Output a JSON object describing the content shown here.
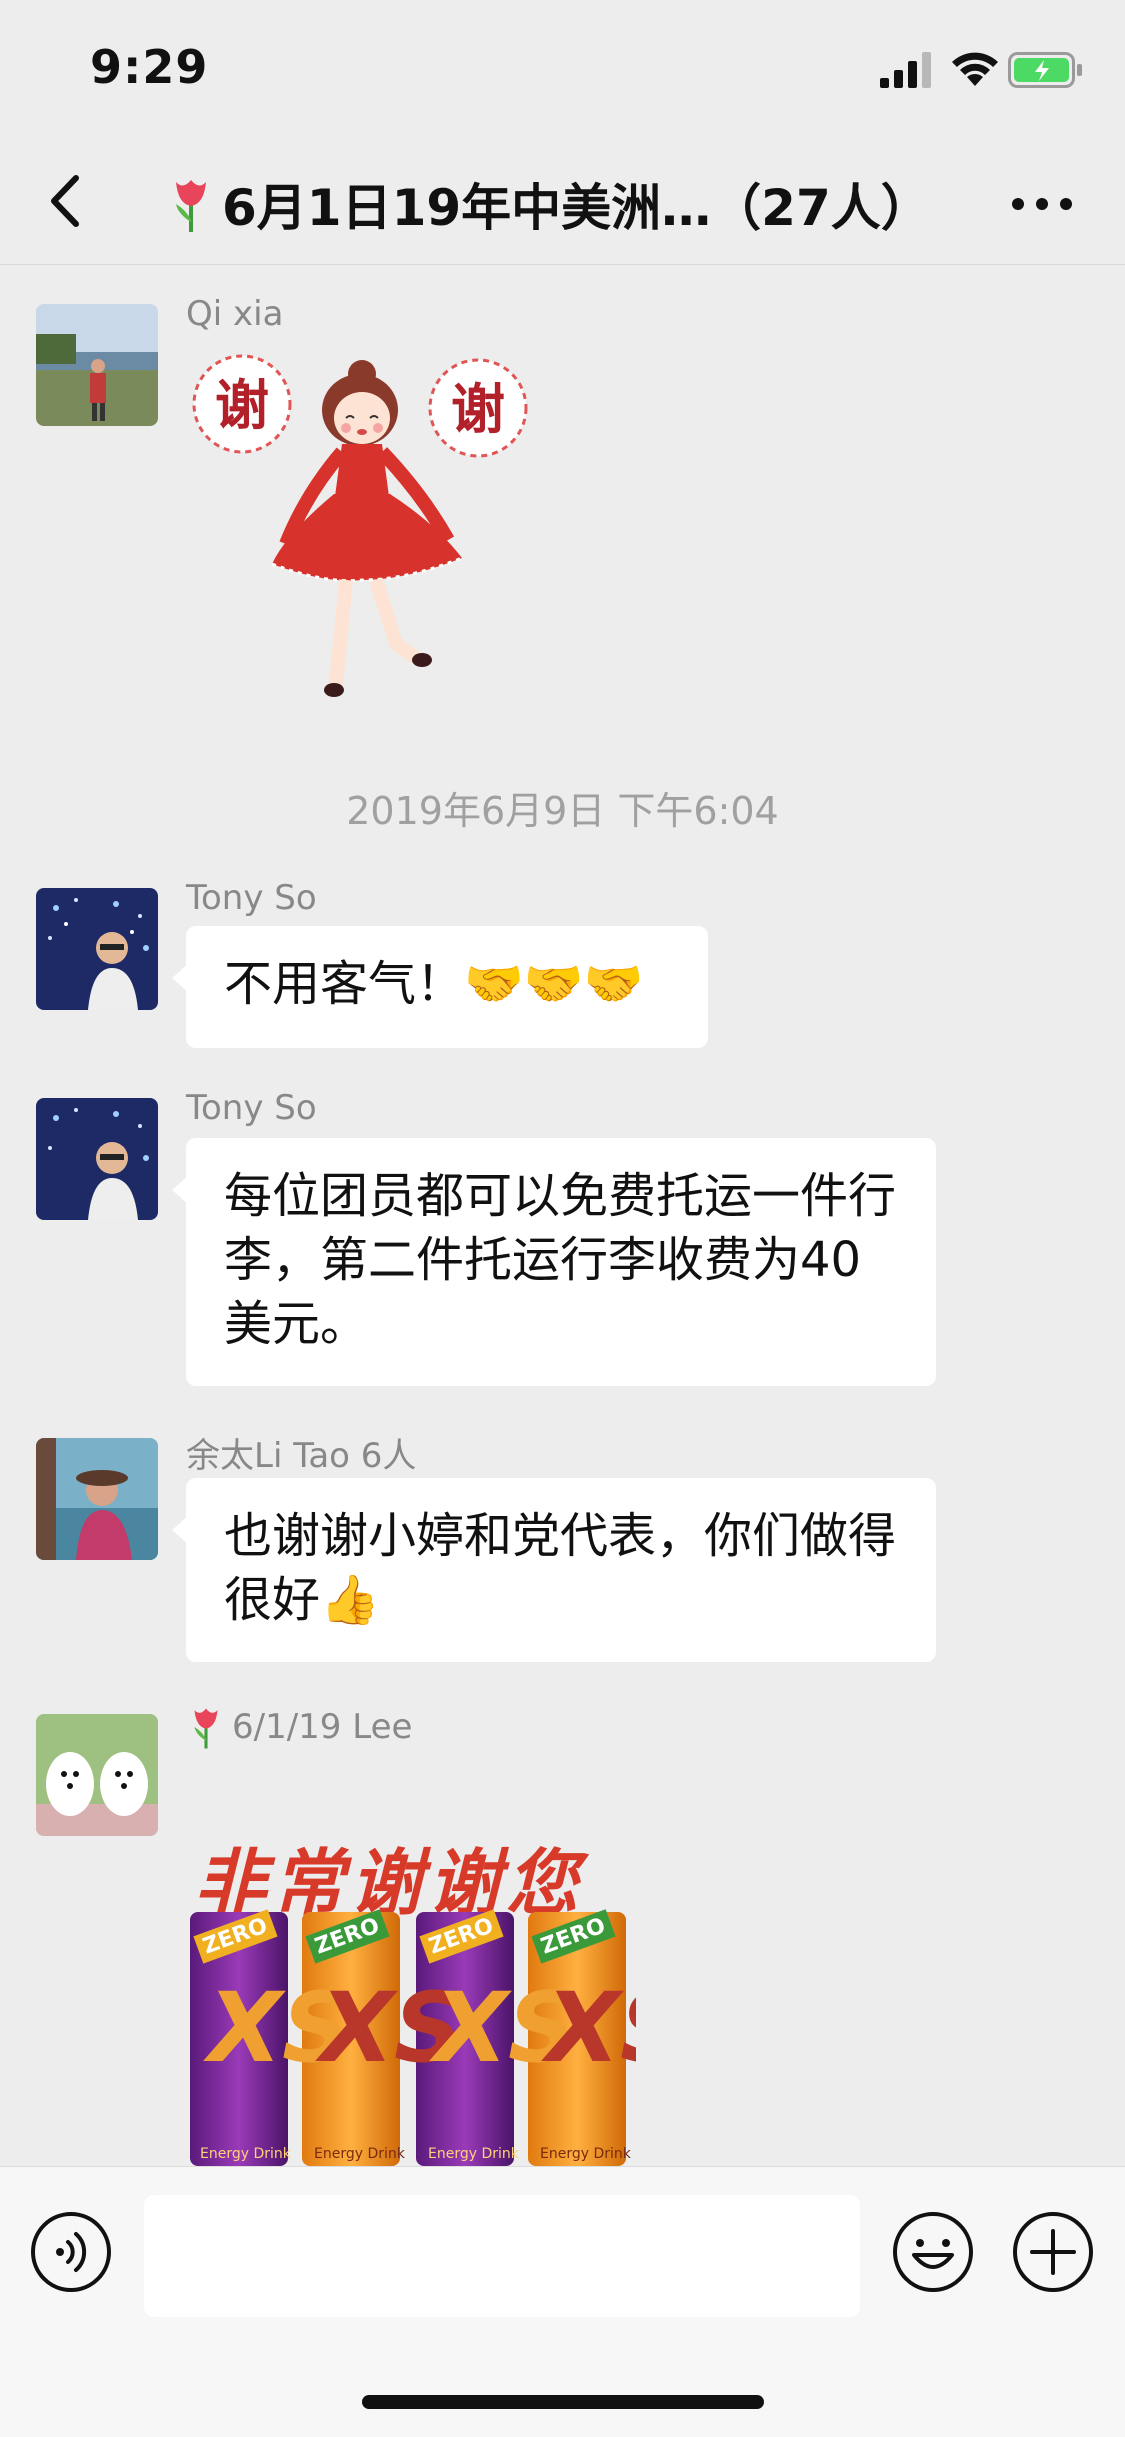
{
  "status_bar": {
    "time": "9:29"
  },
  "nav": {
    "title": "6月1日19年中美洲…（27人）",
    "back_icon": "chevron-left-icon",
    "more_icon": "more-horizontal-icon"
  },
  "messages": [
    {
      "sender": "Qi  xia",
      "type": "sticker",
      "sticker": "girl-curtsy-thanks",
      "sticker_text_left": "谢",
      "sticker_text_right": "谢"
    },
    {
      "type": "timestamp",
      "text": "2019年6月9日 下午6:04"
    },
    {
      "sender": "Tony So",
      "type": "text",
      "text": "不用客气！🤝🤝🤝"
    },
    {
      "sender": "Tony So",
      "type": "text",
      "text": "每位团员都可以免费托运一件行李，第二件托运行李收费为40美元。"
    },
    {
      "sender": "余太Li Tao 6人",
      "type": "text",
      "text": "也谢谢小婷和党代表，你们做得很好👍"
    },
    {
      "sender": "6/1/19 Lee",
      "type": "image",
      "image_text": "非常谢谢您",
      "can_label": "XS",
      "can_sub": "Energy Drink",
      "can_badge": "ZERO"
    }
  ],
  "input_bar": {
    "voice_icon": "voice-icon",
    "emoji_icon": "emoji-icon",
    "plus_icon": "plus-icon",
    "text_value": ""
  },
  "colors": {
    "background": "#ededed",
    "bubble": "#ffffff",
    "title_text": "#111111",
    "sender_text": "#888888",
    "timestamp_text": "#a0a0a0"
  }
}
